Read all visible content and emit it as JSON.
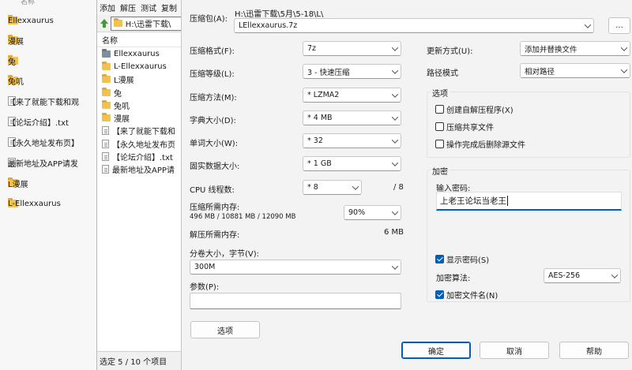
{
  "explorer": {
    "header_partial": "名称",
    "items": [
      {
        "label": "Ellexxaurus",
        "icon": "folder-icon"
      },
      {
        "label": "漫展",
        "icon": "folder-icon"
      },
      {
        "label": "兔",
        "icon": "folder-icon"
      },
      {
        "label": "兔叽",
        "icon": "folder-icon"
      },
      {
        "label": "【来了就能下载和观",
        "icon": "document-icon"
      },
      {
        "label": "【论坛介绍】.txt",
        "icon": "document-icon"
      },
      {
        "label": "【永久地址发布页】",
        "icon": "document-icon"
      },
      {
        "label": "最新地址及APP请发",
        "icon": "document-icon"
      },
      {
        "label": "L漫展",
        "icon": "folder-icon"
      },
      {
        "label": "L-Ellexxaurus",
        "icon": "folder-icon"
      }
    ]
  },
  "file_manager": {
    "menus": [
      "添加",
      "解压",
      "测试",
      "复制"
    ],
    "address": "H:\\迅雷下载\\",
    "column_name": "名称",
    "rows": [
      {
        "label": "Ellexxaurus",
        "icon": "folder-icon"
      },
      {
        "label": "L-Ellexxaurus",
        "icon": "folder-icon"
      },
      {
        "label": "L漫展",
        "icon": "folder-icon"
      },
      {
        "label": "兔",
        "icon": "folder-icon"
      },
      {
        "label": "兔叽",
        "icon": "folder-icon"
      },
      {
        "label": "漫展",
        "icon": "folder-icon"
      },
      {
        "label": "【来了就能下载和",
        "icon": "document-icon"
      },
      {
        "label": "【永久地址发布页",
        "icon": "document-icon"
      },
      {
        "label": "【论坛介绍】.txt",
        "icon": "document-icon"
      },
      {
        "label": "最新地址及APP请",
        "icon": "document-icon"
      }
    ],
    "status": "选定 5 / 10 个项目"
  },
  "dialog": {
    "archive_label": "压缩包(A):",
    "archive_path": "H:\\迅雷下载\\5月\\5-18\\L\\",
    "archive_name": "LEllexxaurus.7z",
    "browse_label": "...",
    "format_label": "压缩格式(F):",
    "format_value": "7z",
    "level_label": "压缩等级(L):",
    "level_value": "3 - 快速压缩",
    "method_label": "压缩方法(M):",
    "method_value": "* LZMA2",
    "dict_label": "字典大小(D):",
    "dict_value": "* 4 MB",
    "word_label": "单词大小(W):",
    "word_value": "* 32",
    "solid_label": "固实数据大小:",
    "solid_value": "* 1 GB",
    "threads_label": "CPU 线程数:",
    "threads_value": "* 8",
    "threads_max": "/ 8",
    "mem_comp_label": "压缩所需内存:",
    "mem_comp_detail": "496 MB / 10881 MB / 12090 MB",
    "mem_comp_percent": "90%",
    "mem_decomp_label": "解压所需内存:",
    "mem_decomp_value": "6 MB",
    "volume_label": "分卷大小，字节(V):",
    "volume_value": "300M",
    "params_label": "参数(P):",
    "params_value": "",
    "options_button": "选项",
    "update_label": "更新方式(U):",
    "update_value": "添加并替换文件",
    "path_label": "路径模式",
    "path_value": "相对路径",
    "options_group": "选项",
    "opt_sfx": "创建自解压程序(X)",
    "opt_shared": "压缩共享文件",
    "opt_delete": "操作完成后删除源文件",
    "encrypt_group": "加密",
    "enter_password_label": "输入密码:",
    "password_value": "上老王论坛当老王",
    "show_password": "显示密码(S)",
    "enc_method_label": "加密算法:",
    "enc_method_value": "AES-256",
    "encrypt_names": "加密文件名(N)",
    "ok": "确定",
    "cancel": "取消",
    "help": "帮助",
    "checks": {
      "sfx": false,
      "shared": false,
      "delete": false,
      "show_password": true,
      "encrypt_names": true
    }
  },
  "colors": {
    "accent": "#005fb8",
    "folder": "#f2c14e"
  }
}
